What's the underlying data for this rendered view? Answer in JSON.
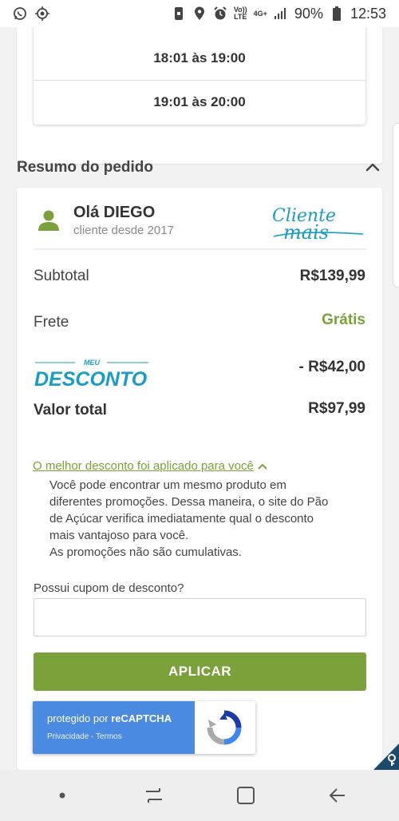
{
  "status_bar": {
    "battery_percent": "90%",
    "time": "12:53",
    "volte": "Vo))\nLTE",
    "network": "4G+"
  },
  "time_slots": [
    "18:01 às 19:00",
    "19:01 às 20:00"
  ],
  "summary": {
    "title": "Resumo do pedido",
    "greeting_name": "Olá DIEGO",
    "greeting_since": "cliente desde 2017",
    "logo_text_line1": "Cliente",
    "logo_text_line2": "mais",
    "subtotal_label": "Subtotal",
    "subtotal_value": "R$139,99",
    "frete_label": "Frete",
    "frete_value": "Grátis",
    "desconto_logo_small": "MEU",
    "desconto_logo_big": "DESCONTO",
    "desconto_value": "- R$42,00",
    "total_label": "Valor total",
    "total_value": "R$97,99"
  },
  "best_discount": {
    "link": "O melhor desconto foi aplicado para você",
    "lines": [
      "Você pode encontrar um mesmo produto em",
      "diferentes promoções. Dessa maneira, o site do Pão",
      "de Açúcar verifica imediatamente qual o desconto",
      "mais vantajoso para você.",
      "As promoções não são cumulativas."
    ]
  },
  "coupon": {
    "label": "Possui cupom de desconto?",
    "value": "",
    "apply_label": "APLICAR"
  },
  "recaptcha": {
    "protected_by": "protegido por ",
    "brand": "reCAPTCHA",
    "links": "Privacidade - Termos"
  },
  "colors": {
    "accent_green": "#7ba23a",
    "recaptcha_blue": "#4a8ae0",
    "logo_teal": "#1b9cc4"
  }
}
